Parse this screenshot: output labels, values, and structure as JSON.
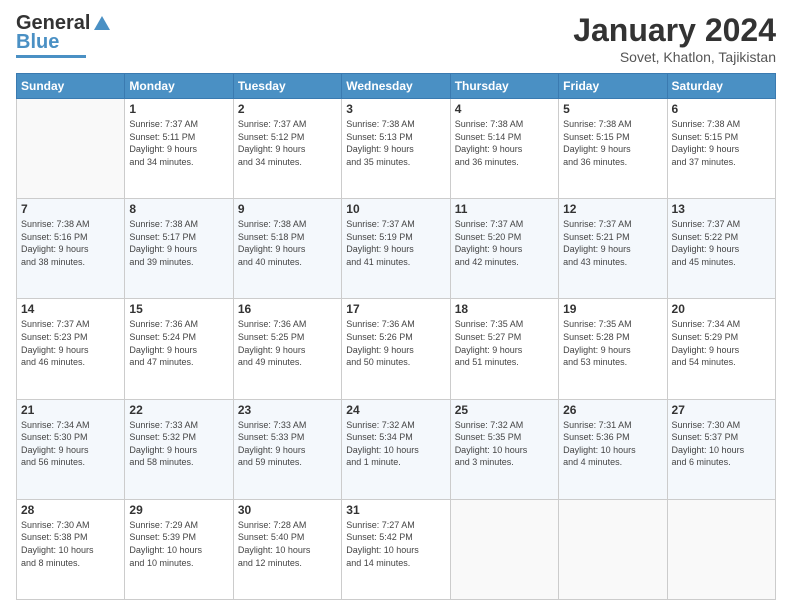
{
  "header": {
    "logo_line1": "General",
    "logo_line2": "Blue",
    "title": "January 2024",
    "subtitle": "Sovet, Khatlon, Tajikistan"
  },
  "days_of_week": [
    "Sunday",
    "Monday",
    "Tuesday",
    "Wednesday",
    "Thursday",
    "Friday",
    "Saturday"
  ],
  "weeks": [
    [
      {
        "day": "",
        "info": ""
      },
      {
        "day": "1",
        "info": "Sunrise: 7:37 AM\nSunset: 5:11 PM\nDaylight: 9 hours\nand 34 minutes."
      },
      {
        "day": "2",
        "info": "Sunrise: 7:37 AM\nSunset: 5:12 PM\nDaylight: 9 hours\nand 34 minutes."
      },
      {
        "day": "3",
        "info": "Sunrise: 7:38 AM\nSunset: 5:13 PM\nDaylight: 9 hours\nand 35 minutes."
      },
      {
        "day": "4",
        "info": "Sunrise: 7:38 AM\nSunset: 5:14 PM\nDaylight: 9 hours\nand 36 minutes."
      },
      {
        "day": "5",
        "info": "Sunrise: 7:38 AM\nSunset: 5:15 PM\nDaylight: 9 hours\nand 36 minutes."
      },
      {
        "day": "6",
        "info": "Sunrise: 7:38 AM\nSunset: 5:15 PM\nDaylight: 9 hours\nand 37 minutes."
      }
    ],
    [
      {
        "day": "7",
        "info": "Sunrise: 7:38 AM\nSunset: 5:16 PM\nDaylight: 9 hours\nand 38 minutes."
      },
      {
        "day": "8",
        "info": "Sunrise: 7:38 AM\nSunset: 5:17 PM\nDaylight: 9 hours\nand 39 minutes."
      },
      {
        "day": "9",
        "info": "Sunrise: 7:38 AM\nSunset: 5:18 PM\nDaylight: 9 hours\nand 40 minutes."
      },
      {
        "day": "10",
        "info": "Sunrise: 7:37 AM\nSunset: 5:19 PM\nDaylight: 9 hours\nand 41 minutes."
      },
      {
        "day": "11",
        "info": "Sunrise: 7:37 AM\nSunset: 5:20 PM\nDaylight: 9 hours\nand 42 minutes."
      },
      {
        "day": "12",
        "info": "Sunrise: 7:37 AM\nSunset: 5:21 PM\nDaylight: 9 hours\nand 43 minutes."
      },
      {
        "day": "13",
        "info": "Sunrise: 7:37 AM\nSunset: 5:22 PM\nDaylight: 9 hours\nand 45 minutes."
      }
    ],
    [
      {
        "day": "14",
        "info": "Sunrise: 7:37 AM\nSunset: 5:23 PM\nDaylight: 9 hours\nand 46 minutes."
      },
      {
        "day": "15",
        "info": "Sunrise: 7:36 AM\nSunset: 5:24 PM\nDaylight: 9 hours\nand 47 minutes."
      },
      {
        "day": "16",
        "info": "Sunrise: 7:36 AM\nSunset: 5:25 PM\nDaylight: 9 hours\nand 49 minutes."
      },
      {
        "day": "17",
        "info": "Sunrise: 7:36 AM\nSunset: 5:26 PM\nDaylight: 9 hours\nand 50 minutes."
      },
      {
        "day": "18",
        "info": "Sunrise: 7:35 AM\nSunset: 5:27 PM\nDaylight: 9 hours\nand 51 minutes."
      },
      {
        "day": "19",
        "info": "Sunrise: 7:35 AM\nSunset: 5:28 PM\nDaylight: 9 hours\nand 53 minutes."
      },
      {
        "day": "20",
        "info": "Sunrise: 7:34 AM\nSunset: 5:29 PM\nDaylight: 9 hours\nand 54 minutes."
      }
    ],
    [
      {
        "day": "21",
        "info": "Sunrise: 7:34 AM\nSunset: 5:30 PM\nDaylight: 9 hours\nand 56 minutes."
      },
      {
        "day": "22",
        "info": "Sunrise: 7:33 AM\nSunset: 5:32 PM\nDaylight: 9 hours\nand 58 minutes."
      },
      {
        "day": "23",
        "info": "Sunrise: 7:33 AM\nSunset: 5:33 PM\nDaylight: 9 hours\nand 59 minutes."
      },
      {
        "day": "24",
        "info": "Sunrise: 7:32 AM\nSunset: 5:34 PM\nDaylight: 10 hours\nand 1 minute."
      },
      {
        "day": "25",
        "info": "Sunrise: 7:32 AM\nSunset: 5:35 PM\nDaylight: 10 hours\nand 3 minutes."
      },
      {
        "day": "26",
        "info": "Sunrise: 7:31 AM\nSunset: 5:36 PM\nDaylight: 10 hours\nand 4 minutes."
      },
      {
        "day": "27",
        "info": "Sunrise: 7:30 AM\nSunset: 5:37 PM\nDaylight: 10 hours\nand 6 minutes."
      }
    ],
    [
      {
        "day": "28",
        "info": "Sunrise: 7:30 AM\nSunset: 5:38 PM\nDaylight: 10 hours\nand 8 minutes."
      },
      {
        "day": "29",
        "info": "Sunrise: 7:29 AM\nSunset: 5:39 PM\nDaylight: 10 hours\nand 10 minutes."
      },
      {
        "day": "30",
        "info": "Sunrise: 7:28 AM\nSunset: 5:40 PM\nDaylight: 10 hours\nand 12 minutes."
      },
      {
        "day": "31",
        "info": "Sunrise: 7:27 AM\nSunset: 5:42 PM\nDaylight: 10 hours\nand 14 minutes."
      },
      {
        "day": "",
        "info": ""
      },
      {
        "day": "",
        "info": ""
      },
      {
        "day": "",
        "info": ""
      }
    ]
  ]
}
